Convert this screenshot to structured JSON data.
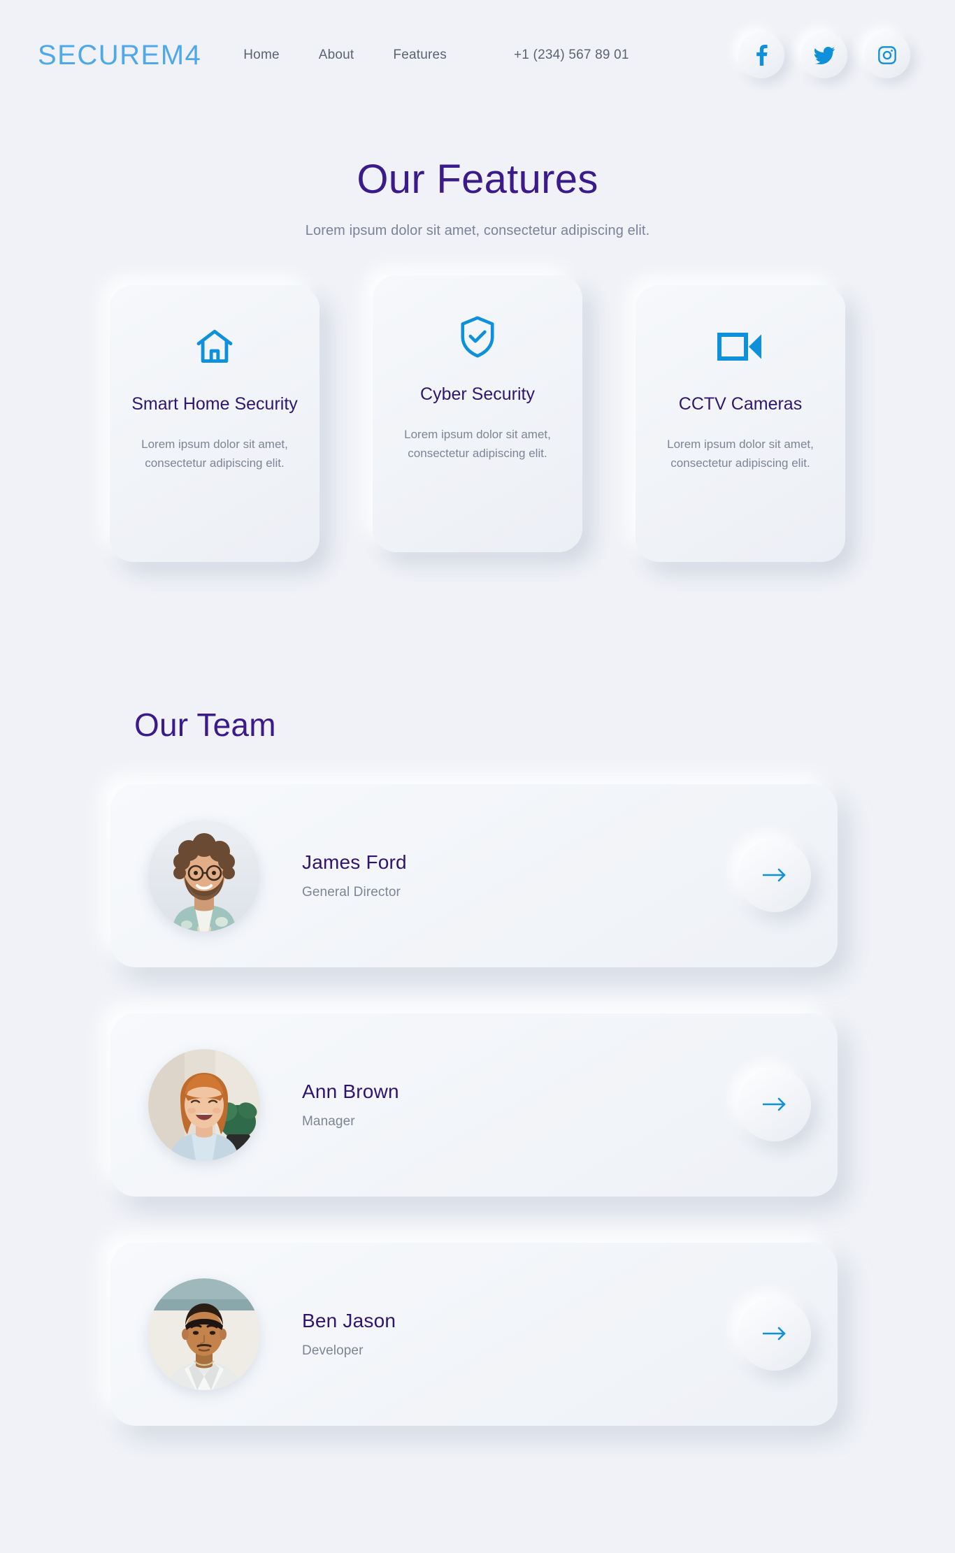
{
  "header": {
    "logo": "SECUREM4",
    "nav": [
      {
        "label": "Home",
        "name": "nav-link-home"
      },
      {
        "label": "About",
        "name": "nav-link-about"
      },
      {
        "label": "Features",
        "name": "nav-link-features"
      }
    ],
    "phone": "+1 (234) 567 89 01",
    "socials": [
      {
        "icon": "facebook-icon",
        "label": "Facebook"
      },
      {
        "icon": "twitter-icon",
        "label": "Twitter"
      },
      {
        "icon": "instagram-icon",
        "label": "Instagram"
      }
    ]
  },
  "features": {
    "title": "Our Features",
    "subtitle": "Lorem ipsum dolor sit amet, consectetur adipiscing elit.",
    "cards": [
      {
        "icon": "home-icon",
        "title": "Smart Home Security",
        "desc": "Lorem ipsum dolor sit amet, consectetur adipiscing elit."
      },
      {
        "icon": "shield-check-icon",
        "title": "Cyber Security",
        "desc": "Lorem ipsum dolor sit amet, consectetur adipiscing elit."
      },
      {
        "icon": "video-camera-icon",
        "title": "CCTV Cameras",
        "desc": "Lorem ipsum dolor sit amet, consectetur adipiscing elit."
      }
    ]
  },
  "team": {
    "title": "Our Team",
    "members": [
      {
        "name": "James Ford",
        "role": "General Director",
        "action_icon": "arrow-right-icon"
      },
      {
        "name": "Ann Brown",
        "role": "Manager",
        "action_icon": "arrow-right-icon"
      },
      {
        "name": "Ben Jason",
        "role": "Developer",
        "action_icon": "arrow-right-icon"
      }
    ]
  },
  "colors": {
    "background": "#f0f2f7",
    "accent_blue": "#0f90da",
    "logo_blue": "#4fa9e8",
    "heading_purple": "#3b1a8c",
    "title_purple": "#31166f",
    "body_gray": "#7d8495",
    "nav_gray": "#5b6273"
  }
}
